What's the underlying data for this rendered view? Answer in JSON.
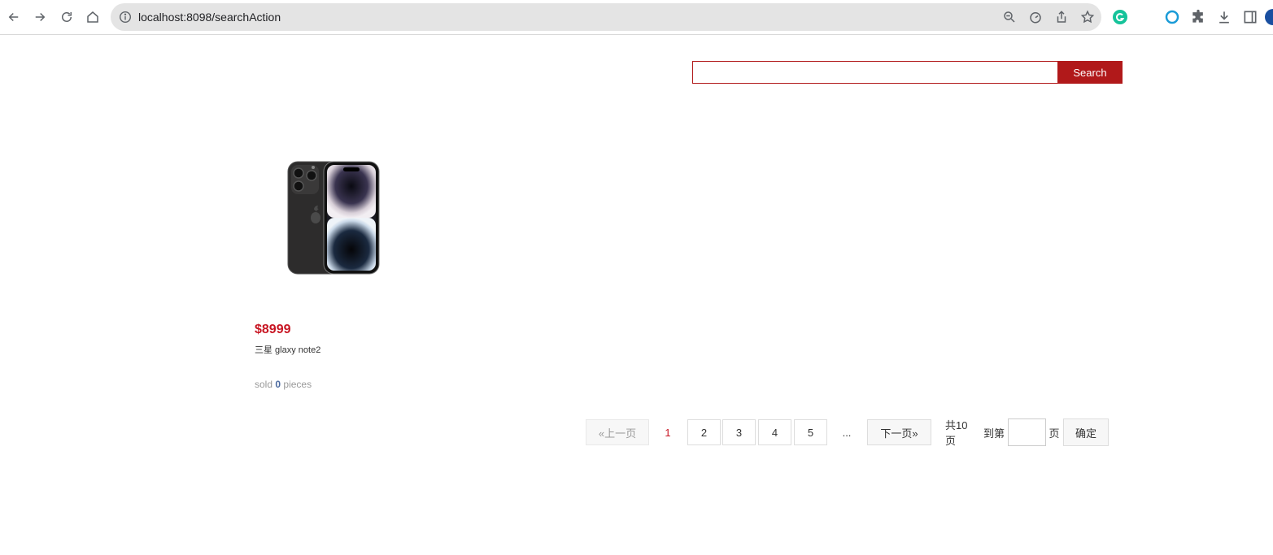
{
  "browser": {
    "url": "localhost:8098/searchAction"
  },
  "search": {
    "value": "",
    "button_label": "Search"
  },
  "product": {
    "price": "$8999",
    "title": "三星 glaxy note2",
    "sold_prefix": "sold",
    "sold_count": "0",
    "sold_suffix": "pieces"
  },
  "pagination": {
    "prev_label": "«上一页",
    "current_page": "1",
    "pages": [
      "2",
      "3",
      "4",
      "5"
    ],
    "ellipsis": "...",
    "next_label": "下一页»",
    "total_label": "共10页",
    "goto_label": "到第",
    "page_unit": "页",
    "confirm_label": "确定"
  },
  "colors": {
    "accent": "#b1191a",
    "price": "#c81623",
    "sold_count": "#4b6aa0"
  }
}
